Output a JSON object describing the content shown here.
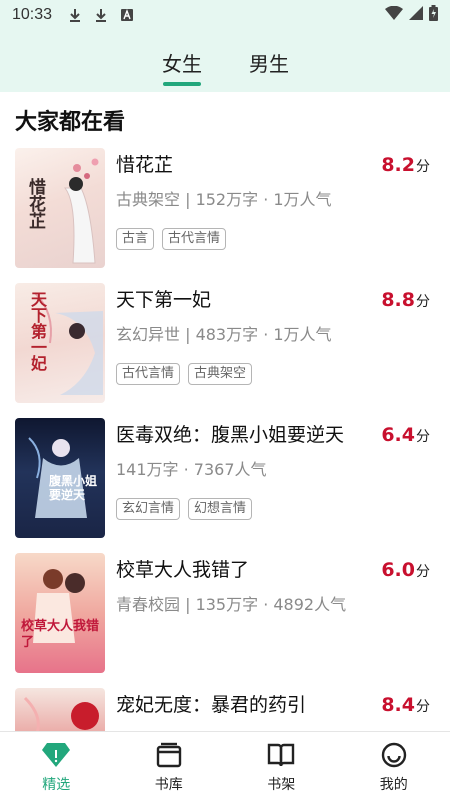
{
  "status_bar": {
    "time": "10:33"
  },
  "tabs": [
    {
      "label": "女生",
      "active": true
    },
    {
      "label": "男生",
      "active": false
    }
  ],
  "section": {
    "title": "大家都在看"
  },
  "books": [
    {
      "title": "惜花芷",
      "cover_text": "惜花芷",
      "meta": "古典架空 | 152万字 · 1万人气",
      "tags": [
        "古言",
        "古代言情"
      ],
      "score": "8.2",
      "unit": "分"
    },
    {
      "title": "天下第一妃",
      "cover_text": "天下第一妃",
      "meta": "玄幻异世 | 483万字 · 1万人气",
      "tags": [
        "古代言情",
        "古典架空"
      ],
      "score": "8.8",
      "unit": "分"
    },
    {
      "title": "医毒双绝：腹黑小姐要逆天",
      "cover_text": "腹黑小姐要逆天",
      "meta": "141万字 · 7367人气",
      "tags": [
        "玄幻言情",
        "幻想言情"
      ],
      "score": "6.4",
      "unit": "分"
    },
    {
      "title": "校草大人我错了",
      "cover_text": "校草大人我错了",
      "meta": "青春校园 | 135万字 · 4892人气",
      "tags": [],
      "score": "6.0",
      "unit": "分"
    },
    {
      "title": "宠妃无度：暴君的药引",
      "cover_text": "",
      "meta": "",
      "tags": [],
      "score": "8.4",
      "unit": "分"
    }
  ],
  "bottom_nav": [
    {
      "label": "精选",
      "icon": "diamond-icon",
      "active": true
    },
    {
      "label": "书库",
      "icon": "library-icon",
      "active": false
    },
    {
      "label": "书架",
      "icon": "book-open-icon",
      "active": false
    },
    {
      "label": "我的",
      "icon": "smiley-icon",
      "active": false
    }
  ],
  "colors": {
    "accent": "#22a77c",
    "score": "#c8102e",
    "header_bg": "#e6f7f1"
  }
}
